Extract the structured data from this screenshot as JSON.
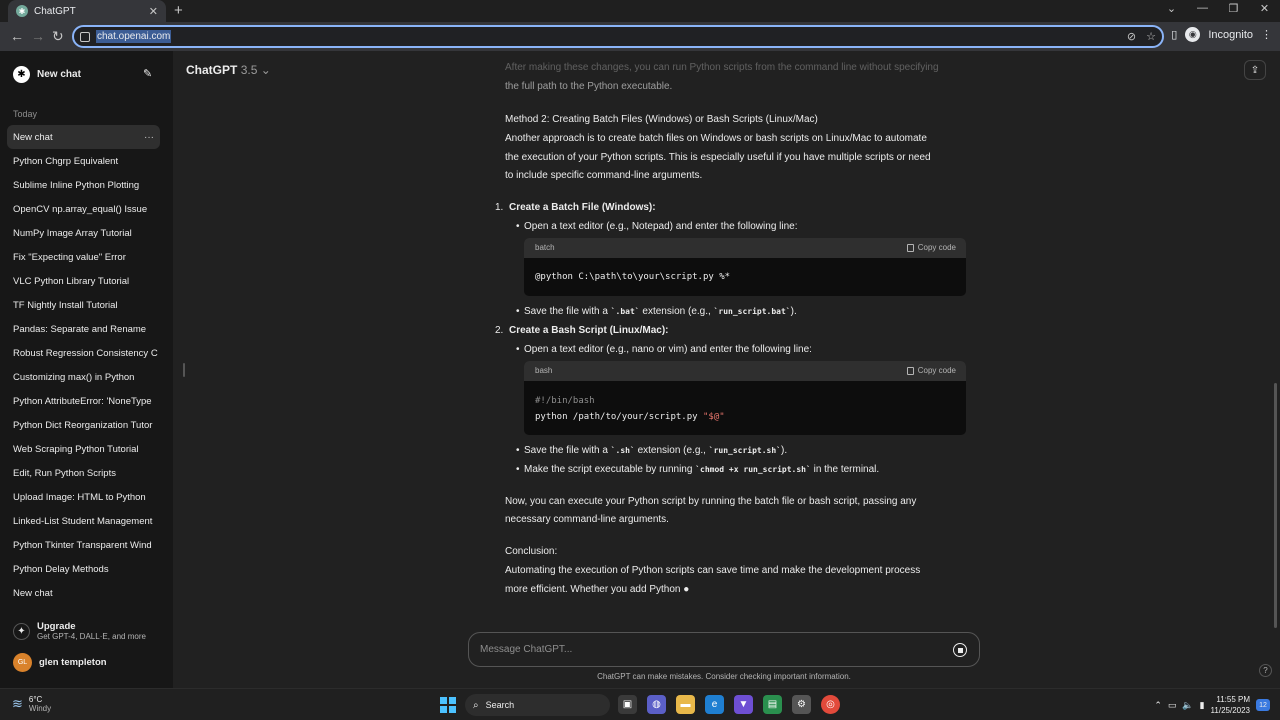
{
  "browser": {
    "tab_title": "ChatGPT",
    "url": "chat.openai.com",
    "incognito_label": "Incognito"
  },
  "sidebar": {
    "new_chat_label": "New chat",
    "section_today": "Today",
    "items": [
      "New chat",
      "Python Chgrp Equivalent",
      "Sublime Inline Python Plotting",
      "OpenCV np.array_equal() Issue",
      "NumPy Image Array Tutorial",
      "Fix \"Expecting value\" Error",
      "VLC Python Library Tutorial",
      "TF Nightly Install Tutorial",
      "Pandas: Separate and Rename",
      "Robust Regression Consistency C",
      "Customizing max() in Python",
      "Python AttributeError: 'NoneType",
      "Python Dict Reorganization Tutor",
      "Web Scraping Python Tutorial",
      "Edit, Run Python Scripts",
      "Upload Image: HTML to Python",
      "Linked-List Student Management",
      "Python Tkinter Transparent Wind",
      "Python Delay Methods",
      "New chat"
    ],
    "upgrade_title": "Upgrade",
    "upgrade_subtitle": "Get GPT-4, DALL·E, and more",
    "user_initials": "GL",
    "user_name": "glen templeton"
  },
  "header": {
    "model_name": "ChatGPT",
    "model_version": "3.5"
  },
  "message": {
    "faded_line_1": "After making these changes, you can run Python scripts from the command line without specifying",
    "faded_line_2": "the full path to the Python executable.",
    "method2_title": "Method 2: Creating Batch Files (Windows) or Bash Scripts (Linux/Mac)",
    "method2_line1": "Another approach is to create batch files on Windows or bash scripts on Linux/Mac to automate",
    "method2_line2": "the execution of your Python scripts. This is especially useful if you have multiple scripts or need",
    "method2_line3": "to include specific command-line arguments.",
    "step1_num": "1.",
    "step1_title": "Create a Batch File (Windows):",
    "step1_b1": "Open a text editor (e.g., Notepad) and enter the following line:",
    "code1_lang": "batch",
    "code1_copy": "Copy code",
    "code1_line": "@python C:\\path\\to\\your\\script.py %*",
    "step1_b2_pre": "Save the file with a ",
    "step1_b2_code1": "`.bat`",
    "step1_b2_mid": " extension (e.g., ",
    "step1_b2_code2": "`run_script.bat`",
    "step1_b2_post": ").",
    "step2_num": "2.",
    "step2_title": "Create a Bash Script (Linux/Mac):",
    "step2_b1": "Open a text editor (e.g., nano or vim) and enter the following line:",
    "code2_lang": "bash",
    "code2_copy": "Copy code",
    "code2_line1": "#!/bin/bash",
    "code2_line2_a": "python /path/to/your/script.py ",
    "code2_line2_b": "\"$@\"",
    "step2_b2_pre": "Save the file with a ",
    "step2_b2_code1": "`.sh`",
    "step2_b2_mid": " extension (e.g., ",
    "step2_b2_code2": "`run_script.sh`",
    "step2_b2_post": ").",
    "step2_b3_pre": "Make the script executable by running ",
    "step2_b3_code": "`chmod +x run_script.sh`",
    "step2_b3_post": " in the terminal.",
    "now_line1": "Now, you can execute your Python script by running the batch file or bash script, passing any",
    "now_line2": "necessary command-line arguments.",
    "conclusion_title": "Conclusion:",
    "conclusion_line1": "Automating the execution of Python scripts can save time and make the development process",
    "conclusion_line2": "more efficient. Whether you add Python"
  },
  "composer": {
    "placeholder": "Message ChatGPT...",
    "disclaimer": "ChatGPT can make mistakes. Consider checking important information."
  },
  "taskbar": {
    "temp": "6°C",
    "weather": "Windy",
    "search_label": "Search",
    "time": "11:55 PM",
    "date": "11/25/2023",
    "notification_count": "12"
  },
  "colors": {
    "sidebar_bg": "#171717",
    "main_bg": "#212121",
    "accent_url": "#8ab4f8"
  }
}
